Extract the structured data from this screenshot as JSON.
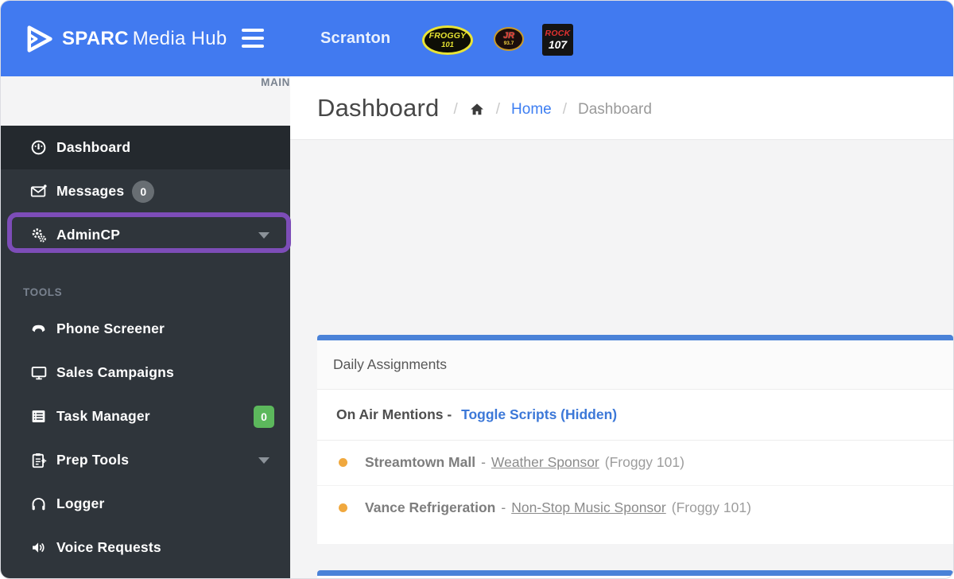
{
  "topbar": {
    "brand_bold": "SPARC",
    "brand_light": "Media Hub",
    "market": "Scranton",
    "stations": [
      {
        "name": "Froggy 101",
        "line1": "FROGGY",
        "line2": "101"
      },
      {
        "name": "JR 93.7",
        "line1": "JR",
        "line2": "93.7"
      },
      {
        "name": "Rock 107",
        "line1": "ROCK",
        "line2": "107"
      }
    ]
  },
  "sidebar": {
    "section_main": "MAIN",
    "section_tools": "TOOLS",
    "items": {
      "dashboard": "Dashboard",
      "messages": "Messages",
      "messages_badge": "0",
      "admincp": "AdminCP",
      "phone": "Phone Screener",
      "sales": "Sales Campaigns",
      "task": "Task Manager",
      "task_badge": "0",
      "prep": "Prep Tools",
      "logger": "Logger",
      "voice": "Voice Requests"
    }
  },
  "page": {
    "title": "Dashboard",
    "breadcrumb": {
      "sep": "/",
      "home": "Home",
      "current": "Dashboard"
    }
  },
  "daily": {
    "title": "Daily Assignments",
    "on_air_label": "On Air Mentions -",
    "toggle_link": "Toggle Scripts (Hidden)",
    "items": [
      {
        "name": "Streamtown Mall",
        "dash": "-",
        "sponsor": "Weather Sponsor",
        "station": "(Froggy 101)"
      },
      {
        "name": "Vance Refrigeration",
        "dash": "-",
        "sponsor": "Non-Stop Music Sponsor",
        "station": "(Froggy 101)"
      }
    ]
  },
  "icons": {
    "brand": "sparc-play-triangle",
    "menu": "hamburger",
    "dashboard": "gauge-icon",
    "messages": "envelope-icon",
    "admincp": "gears-icon",
    "phone": "phone-handset-icon",
    "sales": "monitor-icon",
    "task": "list-icon",
    "prep": "clipboard-arrow-icon",
    "logger": "headphones-icon",
    "voice": "speaker-icon",
    "breadcrumb_home": "home-icon",
    "expand": "chevron-down-icon"
  },
  "colors": {
    "header_blue": "#417af0",
    "panel_accent_blue": "#4a82d8",
    "sidebar_bg": "#2f353b",
    "sidebar_active": "#24292e",
    "purple_highlight": "#7d4db8",
    "link_blue": "#3c78d8",
    "breadcrumb_link_blue": "#3d7ef2",
    "bullet_orange": "#f0a83e",
    "badge_green": "#5cb85c",
    "badge_gray": "#686e73"
  }
}
